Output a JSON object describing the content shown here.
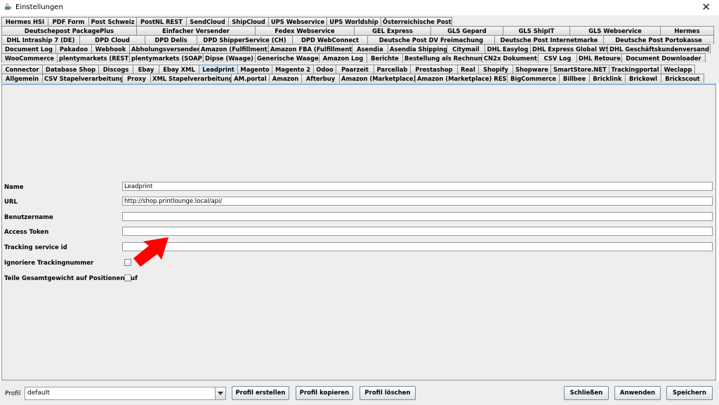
{
  "window": {
    "title": "Einstellungen",
    "close_glyph": "✕",
    "icon": "java-cup-icon"
  },
  "tabs": {
    "active": "Leadprint",
    "rows": [
      [
        "Hermes HSI",
        "PDF Form",
        "Post Schweiz",
        "PostNL REST",
        "SendCloud",
        "ShipCloud",
        "UPS Webservice",
        "UPS Worldship",
        "Österreichische Post"
      ],
      [
        "Deutschepost PackagePlus",
        "Einfacher Versender",
        "Fedex Webservice",
        "GEL Express",
        "GLS Gepard",
        "GLS ShipIT",
        "GLS Webservice",
        "Hermes"
      ],
      [
        "DHL Intraship 7 (DE)",
        "DPD Cloud",
        "DPD Delis",
        "DPD ShipperService (CH)",
        "DPD WebConnect",
        "Deutsche Post DV Freimachung",
        "Deutsche Post Internetmarke",
        "Deutsche Post Portokasse"
      ],
      [
        "Document Log",
        "Pakadoo",
        "Webhook",
        "Abholungsversender",
        "Amazon (Fulfillment)",
        "Amazon FBA (Fulfillment)",
        "Asendia",
        "Asendia Shipping",
        "Citymail",
        "DHL Easylog",
        "DHL Express Global WS",
        "DHL Geschäftskundenversand"
      ],
      [
        "WooCommerce",
        "plentymarkets (REST)",
        "plentymarkets (SOAP)",
        "Dipse (Waage)",
        "Generische Waage",
        "Amazon Log",
        "Berichte",
        "Bestellung als Rechnung",
        "CN2x Dokument",
        "CSV Log",
        "DHL Retoure",
        "Document Downloader"
      ],
      [
        "Connector",
        "Database Shop",
        "Discogs",
        "Ebay",
        "Ebay XML",
        "Leadprint",
        "Magento",
        "Magento 2",
        "Odoo",
        "Paarzeit",
        "Parcellab",
        "Prestashop",
        "Real",
        "Shopify",
        "Shopware",
        "SmartStore.NET",
        "Trackingportal",
        "Weclapp"
      ],
      [
        "Allgemein",
        "CSV Stapelverarbeitung",
        "Proxy",
        "XML Stapelverarbeitung",
        "AM.portal",
        "Amazon",
        "Afterbuy",
        "Amazon (Marketplace)",
        "Amazon (Marketplace) REST",
        "BigCommerce",
        "Billbee",
        "Bricklink",
        "Brickowl",
        "Brickscout"
      ]
    ]
  },
  "form": {
    "name_label": "Name",
    "name_value": "Leadprint",
    "url_label": "URL",
    "url_value": "http://shop.printlounge.local/api/",
    "benutzername_label": "Benutzername",
    "benutzername_value": "",
    "access_token_label": "Access Token",
    "access_token_value": "",
    "tracking_service_id_label": "Tracking service id",
    "tracking_service_id_value": "",
    "ignoriere_tracking_label": "Ignoriere Trackingnummer",
    "ignoriere_tracking_checked": false,
    "teile_gesamtgewicht_label": "Teile Gesamtgewicht auf Positionen auf",
    "teile_gesamtgewicht_checked": false
  },
  "annotation": {
    "arrow_color": "#ff0000"
  },
  "footer": {
    "profil_label": "Profil",
    "profil_value": "default",
    "profil_erstellen": "Profil erstellen",
    "profil_kopieren": "Profil kopieren",
    "profil_loeschen": "Profil löschen",
    "schliessen": "Schließen",
    "anwenden": "Anwenden",
    "speichern": "Speichern"
  }
}
